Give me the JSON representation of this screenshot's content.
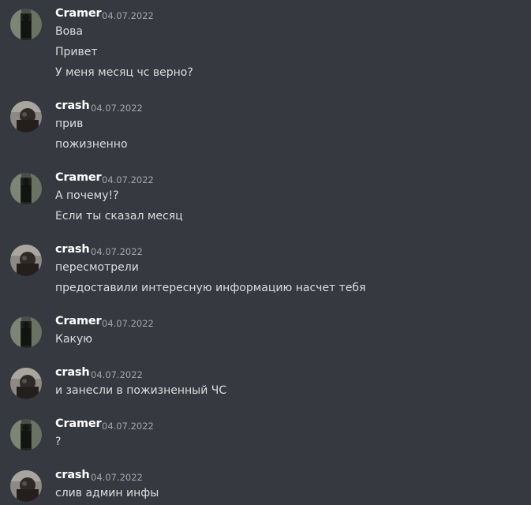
{
  "messages": [
    {
      "author": "Cramer",
      "avatar": "cramer-avatar",
      "timestamp": "04.07.2022",
      "lines": [
        "Вова",
        "Привет",
        "У меня месяц чс верно?"
      ]
    },
    {
      "author": "crash",
      "avatar": "crash-avatar",
      "timestamp": "04.07.2022",
      "lines": [
        "прив",
        "пожизненно"
      ]
    },
    {
      "author": "Cramer",
      "avatar": "cramer-avatar",
      "timestamp": "04.07.2022",
      "lines": [
        "А почему!?",
        "Если ты сказал месяц"
      ]
    },
    {
      "author": "crash",
      "avatar": "crash-avatar",
      "timestamp": "04.07.2022",
      "lines": [
        "пересмотрели",
        "предоставили интересную информацию насчет тебя"
      ]
    },
    {
      "author": "Cramer",
      "avatar": "cramer-avatar",
      "timestamp": "04.07.2022",
      "lines": [
        "Какую"
      ]
    },
    {
      "author": "crash",
      "avatar": "crash-avatar",
      "timestamp": "04.07.2022",
      "lines": [
        "и занесли в пожизненный ЧС"
      ]
    },
    {
      "author": "Cramer",
      "avatar": "cramer-avatar",
      "timestamp": "04.07.2022",
      "lines": [
        "?"
      ]
    },
    {
      "author": "crash",
      "avatar": "crash-avatar",
      "timestamp": "04.07.2022",
      "lines": [
        "слив админ инфы"
      ]
    }
  ],
  "colors": {
    "background": "#36393f",
    "username": "#ffffff",
    "timestamp": "#a3a6aa",
    "message_text": "#dcddde"
  }
}
